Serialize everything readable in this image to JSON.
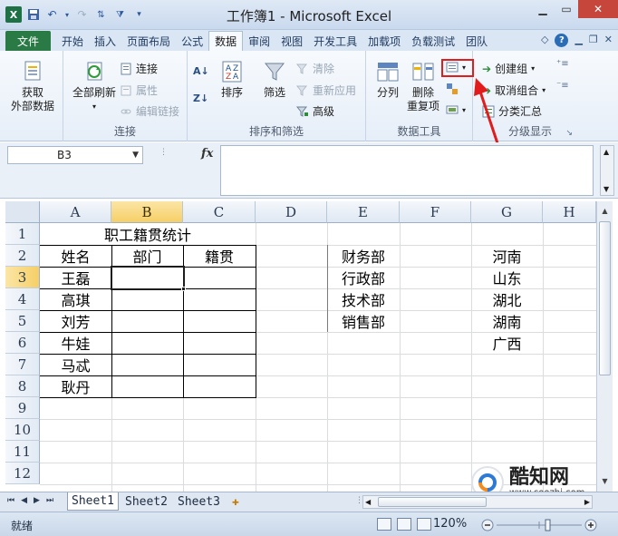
{
  "window": {
    "title": "工作簿1 - Microsoft Excel"
  },
  "quick_access": {
    "items": [
      "save-icon",
      "undo-icon",
      "redo-icon",
      "sort-icon",
      "filter-icon",
      "customize-icon"
    ]
  },
  "tabs": {
    "file": "文件",
    "items": [
      "开始",
      "插入",
      "页面布局",
      "公式",
      "数据",
      "审阅",
      "视图",
      "开发工具",
      "加载项",
      "负载测试",
      "团队"
    ],
    "active": "数据"
  },
  "ribbon": {
    "get_external_data": {
      "line1": "获取",
      "line2": "外部数据"
    },
    "connections": {
      "refresh_all": "全部刷新",
      "connections": "连接",
      "properties": "属性",
      "edit_links": "编辑链接",
      "label": "连接"
    },
    "sort_filter": {
      "sort": "排序",
      "filter": "筛选",
      "clear": "清除",
      "reapply": "重新应用",
      "advanced": "高级",
      "label": "排序和筛选"
    },
    "data_tools": {
      "text_to_columns": "分列",
      "remove_duplicates_1": "删除",
      "remove_duplicates_2": "重复项",
      "label": "数据工具"
    },
    "outline": {
      "group": "创建组",
      "ungroup": "取消组合",
      "subtotal": "分类汇总",
      "label": "分级显示"
    }
  },
  "formula_bar": {
    "name_box": "B3",
    "fx": "fx",
    "formula": ""
  },
  "grid": {
    "columns": [
      "A",
      "B",
      "C",
      "D",
      "E",
      "F",
      "G",
      "H"
    ],
    "rows": [
      "1",
      "2",
      "3",
      "4",
      "5",
      "6",
      "7",
      "8",
      "9",
      "10",
      "11",
      "12"
    ],
    "selected_cell": "B3",
    "title": "职工籍贯统计",
    "headers": [
      "姓名",
      "部门",
      "籍贯"
    ],
    "names": [
      "王磊",
      "高琪",
      "刘芳",
      "牛娃",
      "马忒",
      "耿丹"
    ],
    "departments": [
      "财务部",
      "行政部",
      "技术部",
      "销售部"
    ],
    "provinces": [
      "河南",
      "山东",
      "湖北",
      "湖南",
      "广西"
    ]
  },
  "sheets": {
    "tabs": [
      "Sheet1",
      "Sheet2",
      "Sheet3"
    ],
    "active": "Sheet1"
  },
  "status": {
    "text": "就绪",
    "zoom": "120%"
  },
  "watermark": {
    "name": "酷知网",
    "url": "www.coozhi.com"
  },
  "colors": {
    "file_tab": "#2a7a45",
    "selection_header": "#f6cf65",
    "highlight": "#e01c1c",
    "close_button": "#c7463c"
  }
}
